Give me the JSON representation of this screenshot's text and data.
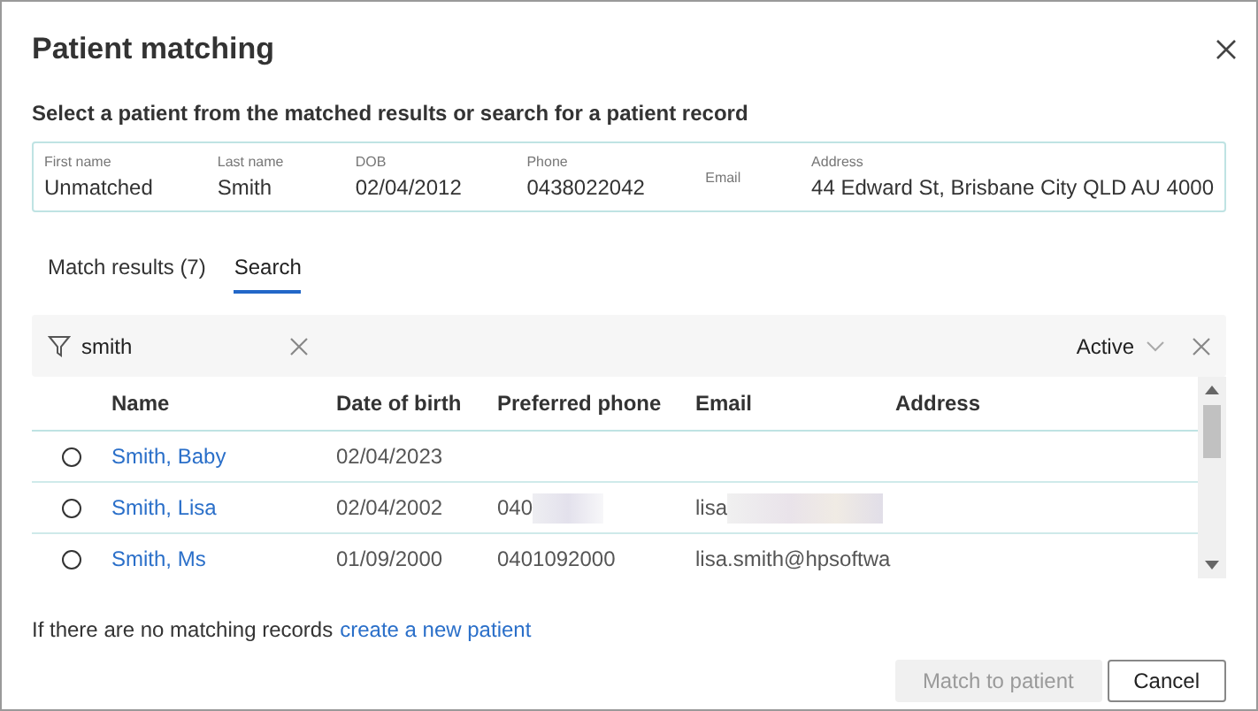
{
  "dialog": {
    "title": "Patient matching",
    "subtitle": "Select a patient from the matched results or search for a patient record"
  },
  "record": [
    {
      "label": "First name",
      "value": "Unmatched"
    },
    {
      "label": "Last name",
      "value": "Smith"
    },
    {
      "label": "DOB",
      "value": "02/04/2012"
    },
    {
      "label": "Phone",
      "value": "0438022042"
    },
    {
      "label": "Email"
    },
    {
      "label": "Address",
      "value": "44 Edward St, Brisbane City QLD AU 4000"
    }
  ],
  "tabs": [
    {
      "label": "Match results (7)",
      "selected": false
    },
    {
      "label": "Search",
      "selected": true
    }
  ],
  "search": {
    "value": "smith",
    "status": "Active"
  },
  "table": {
    "columns": [
      "Name",
      "Date of birth",
      "Preferred phone",
      "Email",
      "Address"
    ],
    "rows": [
      {
        "selected": false,
        "name": "Smith, Baby",
        "dob": "02/04/2023",
        "phone_redacted": false,
        "email_redacted": false
      },
      {
        "selected": false,
        "name": "Smith, Lisa",
        "dob": "02/04/2002",
        "phone": "040",
        "phone_redacted": true,
        "email": "lisa",
        "email_redacted": true
      },
      {
        "selected": false,
        "name": "Smith, Ms",
        "dob": "01/09/2000",
        "phone": "0401092000",
        "phone_redacted": false,
        "email": "lisa.smith@hpsoftwa",
        "email_redacted": false
      }
    ]
  },
  "footer": {
    "text": "If there are no matching records",
    "link": "create a new patient"
  },
  "buttons": [
    {
      "label": "Match to patient",
      "disabled": true
    },
    {
      "label": "Cancel",
      "disabled": false
    }
  ]
}
